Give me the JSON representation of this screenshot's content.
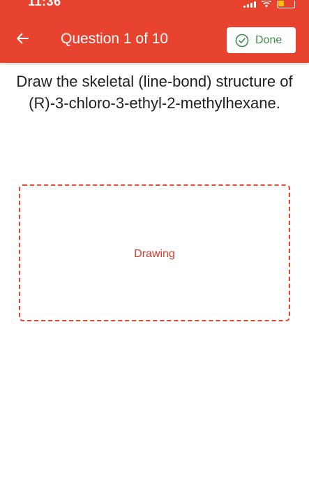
{
  "status_bar": {
    "time": "11:36",
    "icons": [
      "signal-icon",
      "wifi-icon",
      "battery-icon"
    ]
  },
  "header": {
    "back_icon": "back-arrow-icon",
    "title": "Question 1 of 10",
    "done_icon": "check-circle-icon",
    "done_label": "Done"
  },
  "question": {
    "text": "Draw the skeletal (line-bond) structure of (R)-3-chloro-3-ethyl-2-methylhexane."
  },
  "drawing_area": {
    "label": "Drawing"
  },
  "colors": {
    "header_background": "#e8432f",
    "done_accent": "#3f8a4f",
    "drawing_border": "#e8432f",
    "drawing_text": "#d63b2b"
  }
}
